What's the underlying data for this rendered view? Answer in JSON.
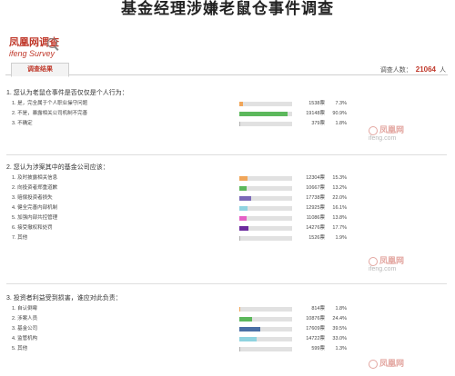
{
  "page_title": "基金经理涉嫌老鼠仓事件调查",
  "brand": {
    "name_cn": "凤凰网调查",
    "name_en": "ifeng Survey"
  },
  "tab_label": "调查结果",
  "participants": {
    "label": "调查人数：",
    "value": "21064",
    "unit": "人"
  },
  "watermark": {
    "text": "凤凰网",
    "sub": "ifeng.com"
  },
  "colors": {
    "orange": "#f0a65a",
    "green": "#5cb85c",
    "purple": "#7b69b8",
    "cyan": "#8fd3e0",
    "pink": "#e561c6",
    "violet": "#6c2b9e",
    "gray": "#b0b0b0",
    "blue": "#4a6fa5"
  },
  "sections": [
    {
      "question": "1. 您认为老鼠仓事件是否仅仅是个人行为：",
      "options": [
        {
          "label": "1. 是，完全属于个人职业操守问题",
          "votes": "1538票",
          "pct": "7.3%",
          "share": 7.3,
          "color": "#f0a65a"
        },
        {
          "label": "2. 不是，暴露相关公司机制不完善",
          "votes": "19148票",
          "pct": "90.9%",
          "share": 90.9,
          "color": "#5cb85c"
        },
        {
          "label": "3. 不确定",
          "votes": "379票",
          "pct": "1.8%",
          "share": 1.8,
          "color": "#b0b0b0"
        }
      ]
    },
    {
      "question": "2. 您认为涉案其中的基金公司应该：",
      "options": [
        {
          "label": "1. 及时披露相关信息",
          "votes": "12304票",
          "pct": "15.3%",
          "share": 15.3,
          "color": "#f0a65a"
        },
        {
          "label": "2. 向投资者郑重道歉",
          "votes": "10667票",
          "pct": "13.2%",
          "share": 13.2,
          "color": "#5cb85c"
        },
        {
          "label": "3. 赔偿投资者损失",
          "votes": "17738票",
          "pct": "22.0%",
          "share": 22.0,
          "color": "#7b69b8"
        },
        {
          "label": "4. 健全完善内部机制",
          "votes": "12925票",
          "pct": "16.1%",
          "share": 16.1,
          "color": "#8fd3e0"
        },
        {
          "label": "5. 加强内部共控管理",
          "votes": "11086票",
          "pct": "13.8%",
          "share": 13.8,
          "color": "#e561c6"
        },
        {
          "label": "6. 接受撤权和处罚",
          "votes": "14276票",
          "pct": "17.7%",
          "share": 17.7,
          "color": "#6c2b9e"
        },
        {
          "label": "7. 其他",
          "votes": "1526票",
          "pct": "1.9%",
          "share": 1.9,
          "color": "#b0b0b0"
        }
      ]
    },
    {
      "question": "3. 投资者利益受到损害，谁应对此负责：",
      "options": [
        {
          "label": "1. 自认倒霉",
          "votes": "814票",
          "pct": "1.8%",
          "share": 1.8,
          "color": "#f0a65a"
        },
        {
          "label": "2. 涉案人员",
          "votes": "10876票",
          "pct": "24.4%",
          "share": 24.4,
          "color": "#5cb85c"
        },
        {
          "label": "3. 基金公司",
          "votes": "17609票",
          "pct": "39.5%",
          "share": 39.5,
          "color": "#4a6fa5"
        },
        {
          "label": "4. 监管机构",
          "votes": "14722票",
          "pct": "33.0%",
          "share": 33.0,
          "color": "#8fd3e0"
        },
        {
          "label": "5. 其他",
          "votes": "599票",
          "pct": "1.3%",
          "share": 1.3,
          "color": "#b0b0b0"
        }
      ]
    }
  ]
}
